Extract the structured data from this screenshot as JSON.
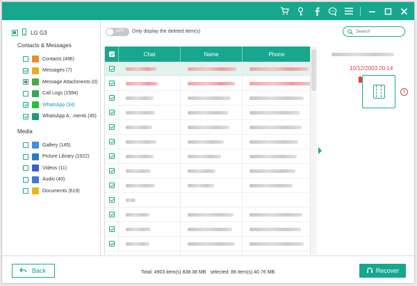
{
  "window": {
    "title_icons": [
      "cart-icon",
      "key-icon",
      "facebook-icon",
      "feedback-icon",
      "menu-icon",
      "minimize-icon",
      "maximize-icon",
      "close-icon"
    ]
  },
  "sidebar": {
    "device": "LG G3",
    "sections": [
      {
        "title": "Contacts & Messages",
        "items": [
          {
            "label": "Contacts (496)",
            "state": "unchecked",
            "icon": "contacts-icon",
            "color": "#f08a2c"
          },
          {
            "label": "Messages (7)",
            "state": "checked",
            "icon": "messages-icon",
            "color": "#f2a91f"
          },
          {
            "label": "Message Attachments (0)",
            "state": "partial-grey",
            "icon": "attachment-icon",
            "color": "#49a94a"
          },
          {
            "label": "Call Logs (1584)",
            "state": "unchecked",
            "icon": "call-logs-icon",
            "color": "#34a853"
          },
          {
            "label": "WhatsApp (34)",
            "state": "checked",
            "icon": "whatsapp-icon",
            "color": "#25c03f",
            "selected": true
          },
          {
            "label": "WhatsApp A...ments (45)",
            "state": "checked",
            "icon": "whatsapp-attachments-icon",
            "color": "#1a9c7c"
          }
        ]
      },
      {
        "title": "Media",
        "items": [
          {
            "label": "Gallery (145)",
            "state": "unchecked",
            "icon": "gallery-icon",
            "color": "#3f8ee0"
          },
          {
            "label": "Picture Library (1922)",
            "state": "unchecked",
            "icon": "picture-library-icon",
            "color": "#2f79c8"
          },
          {
            "label": "Videos (11)",
            "state": "unchecked",
            "icon": "videos-icon",
            "color": "#3a5fcf"
          },
          {
            "label": "Audio (40)",
            "state": "unchecked",
            "icon": "audio-icon",
            "color": "#4278d8"
          },
          {
            "label": "Documents (619)",
            "state": "unchecked",
            "icon": "documents-icon",
            "color": "#f2b318"
          }
        ]
      }
    ]
  },
  "toolbar": {
    "toggle_state": "OFF",
    "only_deleted_label": "Only display the deleted item(s)",
    "search_placeholder": "Search"
  },
  "table": {
    "columns": [
      "Chat",
      "Name",
      "Phone"
    ],
    "rows": [
      {
        "checked": true,
        "deleted": true,
        "highlighted": true,
        "chat_w": 44,
        "name_w": 70,
        "phone_w": 85,
        "name_blank": false,
        "phone_blank": false
      },
      {
        "checked": true,
        "deleted": true,
        "highlighted": false,
        "chat_w": 46,
        "name_w": 68,
        "phone_w": 88,
        "name_blank": false,
        "phone_blank": false
      },
      {
        "checked": true,
        "deleted": false,
        "highlighted": false,
        "chat_w": 40,
        "name_w": 62,
        "phone_w": 78,
        "name_blank": false,
        "phone_blank": false
      },
      {
        "checked": true,
        "deleted": false,
        "highlighted": false,
        "chat_w": 42,
        "name_w": 58,
        "phone_w": 72,
        "name_blank": false,
        "phone_blank": false
      },
      {
        "checked": true,
        "deleted": false,
        "highlighted": false,
        "chat_w": 38,
        "name_w": 60,
        "phone_w": 75,
        "name_blank": false,
        "phone_blank": false
      },
      {
        "checked": true,
        "deleted": false,
        "highlighted": false,
        "chat_w": 44,
        "name_w": 52,
        "phone_w": 70,
        "name_blank": false,
        "phone_blank": false
      },
      {
        "checked": true,
        "deleted": false,
        "highlighted": false,
        "chat_w": 40,
        "name_w": 48,
        "phone_w": 68,
        "name_blank": false,
        "phone_blank": false
      },
      {
        "checked": true,
        "deleted": false,
        "highlighted": false,
        "chat_w": 36,
        "name_w": 40,
        "phone_w": 66,
        "name_blank": false,
        "phone_blank": false
      },
      {
        "checked": true,
        "deleted": false,
        "highlighted": false,
        "chat_w": 42,
        "name_w": 38,
        "phone_w": 62,
        "name_blank": false,
        "phone_blank": false
      },
      {
        "checked": true,
        "deleted": false,
        "highlighted": false,
        "chat_w": 14,
        "name_w": 0,
        "phone_w": 0,
        "name_blank": true,
        "phone_blank": true
      },
      {
        "checked": true,
        "deleted": false,
        "highlighted": false,
        "chat_w": 34,
        "name_w": 66,
        "phone_w": 76,
        "name_blank": false,
        "phone_blank": false
      },
      {
        "checked": true,
        "deleted": false,
        "highlighted": false,
        "chat_w": 36,
        "name_w": 64,
        "phone_w": 74,
        "name_blank": false,
        "phone_blank": false
      },
      {
        "checked": true,
        "deleted": false,
        "highlighted": false,
        "chat_w": 34,
        "name_w": 68,
        "phone_w": 78,
        "name_blank": false,
        "phone_blank": false
      },
      {
        "checked": true,
        "deleted": false,
        "highlighted": false,
        "chat_w": 38,
        "name_w": 62,
        "phone_w": 72,
        "name_blank": false,
        "phone_blank": false
      }
    ]
  },
  "preview": {
    "timestamp": "10/12/2003 20:14",
    "error_mark": "!"
  },
  "footer": {
    "back_label": "Back",
    "status": "Total: 4903 item(s) 838.38 MB   selected: 86 item(s) 40.76 MB",
    "recover_label": "Recover"
  },
  "colors": {
    "accent": "#17a78e",
    "deleted": "#e23b3b",
    "selected_link": "#1a8fd6"
  }
}
